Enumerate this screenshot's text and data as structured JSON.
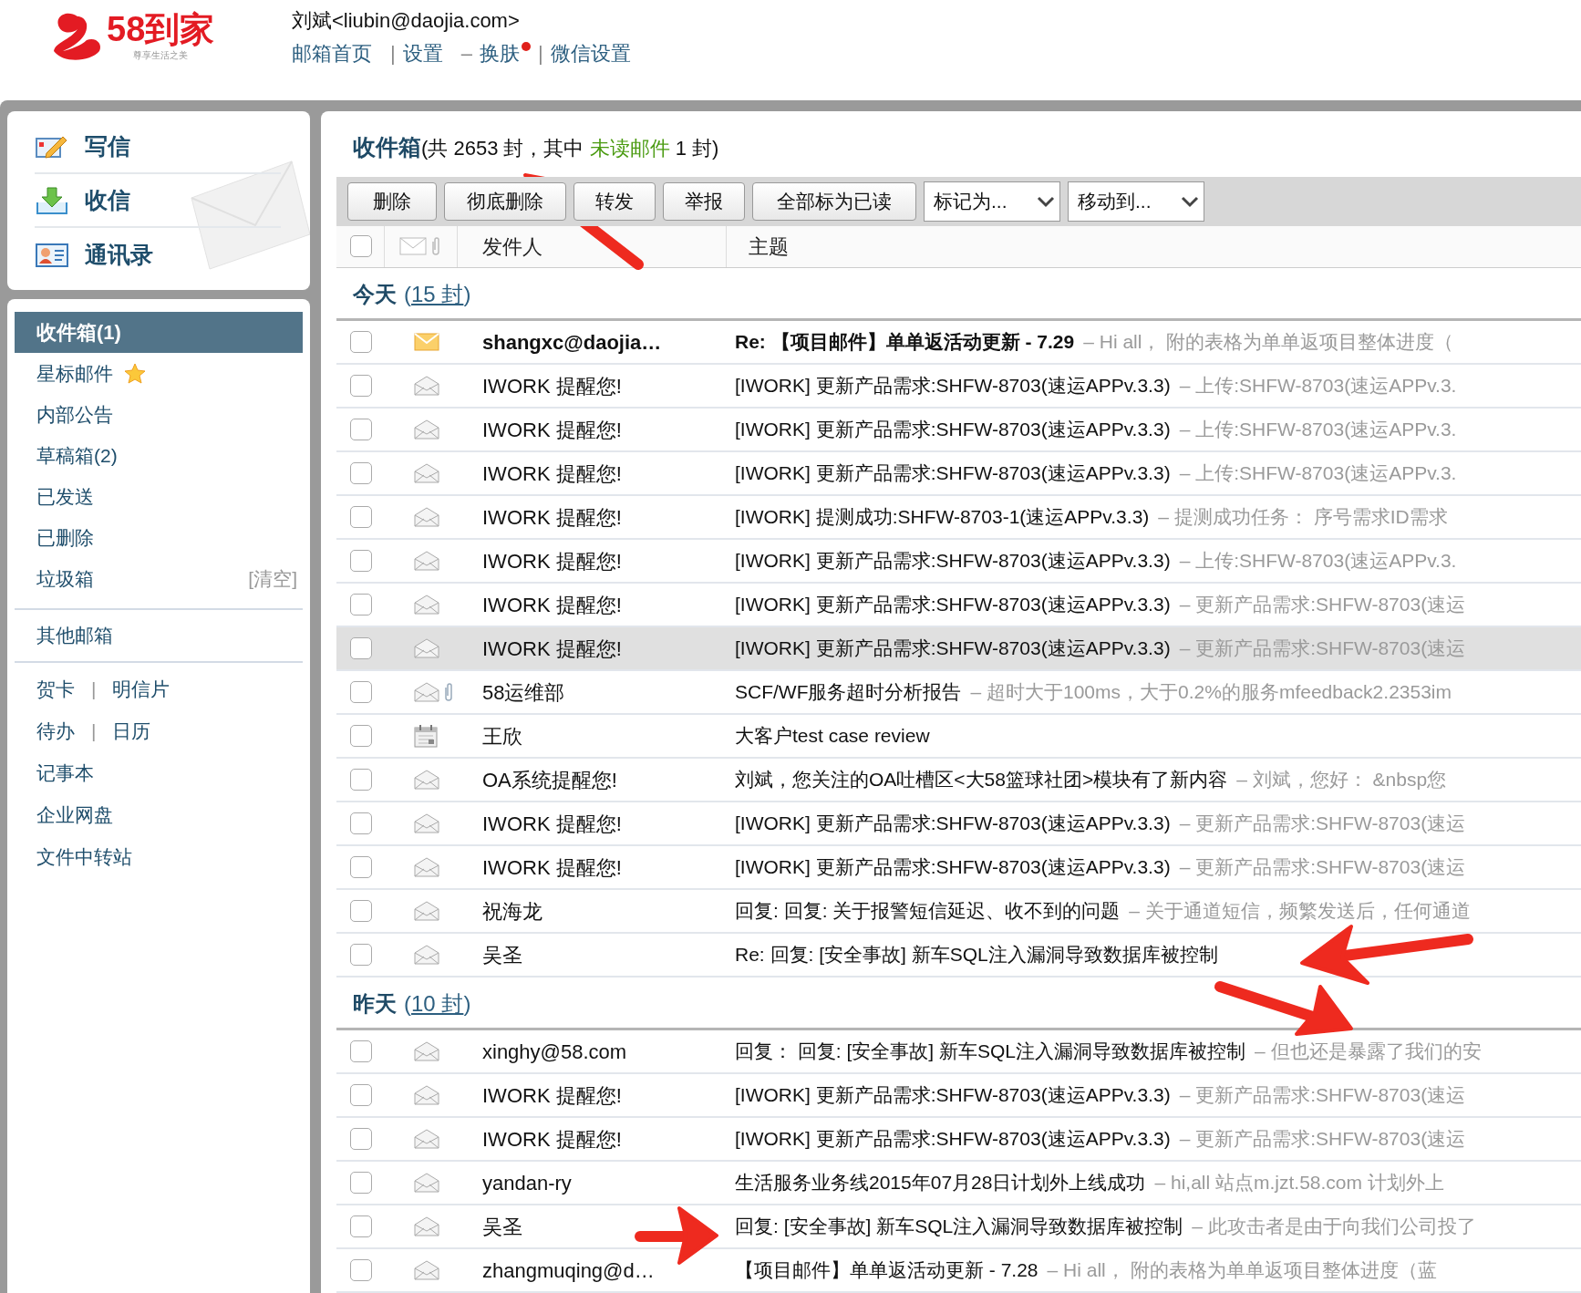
{
  "header": {
    "brand": "58到家",
    "tagline": "尊享生活之美",
    "user": "刘斌<liubin@daojia.com>",
    "nav": [
      {
        "kind": "link",
        "text": "邮箱首页",
        "badge": false
      },
      {
        "kind": "sep",
        "text": "|"
      },
      {
        "kind": "link",
        "text": "设置",
        "badge": false
      },
      {
        "kind": "sep",
        "text": "–"
      },
      {
        "kind": "link",
        "text": "换肤",
        "badge": true
      },
      {
        "kind": "sep",
        "text": "|"
      },
      {
        "kind": "link",
        "text": "微信设置",
        "badge": false
      }
    ]
  },
  "quick_actions": [
    {
      "kind": "compose",
      "label": "写信"
    },
    {
      "kind": "receive",
      "label": "收信"
    },
    {
      "kind": "contacts",
      "label": "通讯录"
    }
  ],
  "folders": [
    {
      "kind": "folder",
      "label": "收件箱(1)",
      "selected": true
    },
    {
      "kind": "starred",
      "label": "星标邮件",
      "selected": false
    },
    {
      "kind": "folder",
      "label": "内部公告",
      "selected": false
    },
    {
      "kind": "folder",
      "label": "草稿箱(2)",
      "selected": false
    },
    {
      "kind": "folder",
      "label": "已发送",
      "selected": false
    },
    {
      "kind": "folder",
      "label": "已删除",
      "selected": false
    },
    {
      "kind": "folder",
      "label": "垃圾箱",
      "selected": false,
      "action": "[清空]"
    }
  ],
  "other_mailbox": "其他邮箱",
  "tools": [
    {
      "items": [
        "贺卡",
        "明信片"
      ],
      "separator": "|"
    },
    {
      "items": [
        "待办",
        "日历"
      ],
      "separator": "|"
    },
    {
      "items": [
        "记事本"
      ]
    },
    {
      "items": [
        "企业网盘"
      ]
    },
    {
      "items": [
        "文件中转站"
      ]
    }
  ],
  "inbox": {
    "title": "收件箱",
    "summary_before": "(共 2653 封，其中 ",
    "unread_link": "未读邮件",
    "summary_after": " 1 封)"
  },
  "toolbar": {
    "buttons": [
      "删除",
      "彻底删除",
      "转发",
      "举报",
      "全部标为已读"
    ],
    "dropdowns": [
      "标记为...",
      "移动到..."
    ]
  },
  "columns": {
    "select_all_checked": false,
    "sender": "发件人",
    "subject": "主题"
  },
  "groups": [
    {
      "label": "今天",
      "open": "(",
      "count": "15 封",
      "close": ")",
      "rows": [
        {
          "kind": "unread",
          "attachment": false,
          "unread": true,
          "highlighted": false,
          "checked": false,
          "sender": "shangxc@daojia…",
          "subject": "Re: 【项目邮件】单单返活动更新 - 7.29",
          "preview": "– Hi all， 附的表格为单单返项目整体进度（"
        },
        {
          "kind": "read",
          "attachment": false,
          "unread": false,
          "highlighted": false,
          "checked": false,
          "sender": "IWORK 提醒您!",
          "subject": "[IWORK] 更新产品需求:SHFW-8703(速运APPv.3.3)",
          "preview": "– 上传:SHFW-8703(速运APPv.3."
        },
        {
          "kind": "read",
          "attachment": false,
          "unread": false,
          "highlighted": false,
          "checked": false,
          "sender": "IWORK 提醒您!",
          "subject": "[IWORK] 更新产品需求:SHFW-8703(速运APPv.3.3)",
          "preview": "– 上传:SHFW-8703(速运APPv.3."
        },
        {
          "kind": "read",
          "attachment": false,
          "unread": false,
          "highlighted": false,
          "checked": false,
          "sender": "IWORK 提醒您!",
          "subject": "[IWORK] 更新产品需求:SHFW-8703(速运APPv.3.3)",
          "preview": "– 上传:SHFW-8703(速运APPv.3."
        },
        {
          "kind": "read",
          "attachment": false,
          "unread": false,
          "highlighted": false,
          "checked": false,
          "sender": "IWORK 提醒您!",
          "subject": "[IWORK] 提测成功:SHFW-8703-1(速运APPv.3.3)",
          "preview": "– 提测成功任务：  序号需求ID需求"
        },
        {
          "kind": "read",
          "attachment": false,
          "unread": false,
          "highlighted": false,
          "checked": false,
          "sender": "IWORK 提醒您!",
          "subject": "[IWORK] 更新产品需求:SHFW-8703(速运APPv.3.3)",
          "preview": "– 上传:SHFW-8703(速运APPv.3."
        },
        {
          "kind": "read",
          "attachment": false,
          "unread": false,
          "highlighted": false,
          "checked": false,
          "sender": "IWORK 提醒您!",
          "subject": "[IWORK] 更新产品需求:SHFW-8703(速运APPv.3.3)",
          "preview": "– 更新产品需求:SHFW-8703(速运"
        },
        {
          "kind": "read",
          "attachment": false,
          "unread": false,
          "highlighted": true,
          "checked": false,
          "sender": "IWORK 提醒您!",
          "subject": "[IWORK] 更新产品需求:SHFW-8703(速运APPv.3.3)",
          "preview": "– 更新产品需求:SHFW-8703(速运"
        },
        {
          "kind": "read",
          "attachment": true,
          "unread": false,
          "highlighted": false,
          "checked": false,
          "sender": "58运维部",
          "subject": "SCF/WF服务超时分析报告",
          "preview": "– 超时大于100ms，大于0.2%的服务mfeedback2.2353im"
        },
        {
          "kind": "calendar",
          "attachment": false,
          "unread": false,
          "highlighted": false,
          "checked": false,
          "sender": "王欣",
          "subject": "大客户test case review"
        },
        {
          "kind": "read",
          "attachment": false,
          "unread": false,
          "highlighted": false,
          "checked": false,
          "sender": "OA系统提醒您!",
          "subject": "刘斌，您关注的OA吐槽区<大58篮球社团>模块有了新内容",
          "preview": "– 刘斌，您好：  &nbsp您"
        },
        {
          "kind": "read",
          "attachment": false,
          "unread": false,
          "highlighted": false,
          "checked": false,
          "sender": "IWORK 提醒您!",
          "subject": "[IWORK] 更新产品需求:SHFW-8703(速运APPv.3.3)",
          "preview": "– 更新产品需求:SHFW-8703(速运"
        },
        {
          "kind": "read",
          "attachment": false,
          "unread": false,
          "highlighted": false,
          "checked": false,
          "sender": "IWORK 提醒您!",
          "subject": "[IWORK] 更新产品需求:SHFW-8703(速运APPv.3.3)",
          "preview": "– 更新产品需求:SHFW-8703(速运"
        },
        {
          "kind": "read",
          "attachment": false,
          "unread": false,
          "highlighted": false,
          "checked": false,
          "sender": "祝海龙",
          "subject": "回复: 回复: 关于报警短信延迟、收不到的问题",
          "preview": "– 关于通道短信，频繁发送后，任何通道"
        },
        {
          "kind": "read",
          "attachment": false,
          "unread": false,
          "highlighted": false,
          "checked": false,
          "sender": "吴圣",
          "subject": "Re: 回复: [安全事故] 新车SQL注入漏洞导致数据库被控制"
        }
      ]
    },
    {
      "label": "昨天",
      "open": "(",
      "count": "10 封",
      "close": ")",
      "rows": [
        {
          "kind": "read",
          "attachment": false,
          "unread": false,
          "highlighted": false,
          "checked": false,
          "sender": "xinghy@58.com",
          "subject": "回复： 回复: [安全事故] 新车SQL注入漏洞导致数据库被控制",
          "preview": "– 但也还是暴露了我们的安"
        },
        {
          "kind": "read",
          "attachment": false,
          "unread": false,
          "highlighted": false,
          "checked": false,
          "sender": "IWORK 提醒您!",
          "subject": "[IWORK] 更新产品需求:SHFW-8703(速运APPv.3.3)",
          "preview": "– 更新产品需求:SHFW-8703(速运"
        },
        {
          "kind": "read",
          "attachment": false,
          "unread": false,
          "highlighted": false,
          "checked": false,
          "sender": "IWORK 提醒您!",
          "subject": "[IWORK] 更新产品需求:SHFW-8703(速运APPv.3.3)",
          "preview": "– 更新产品需求:SHFW-8703(速运"
        },
        {
          "kind": "read",
          "attachment": false,
          "unread": false,
          "highlighted": false,
          "checked": false,
          "sender": "yandan-ry",
          "subject": "生活服务业务线2015年07月28日计划外上线成功",
          "preview": "– hi,all 站点m.jzt.58.com 计划外上"
        },
        {
          "kind": "read",
          "attachment": false,
          "unread": false,
          "highlighted": false,
          "checked": false,
          "sender": "吴圣",
          "subject": "回复: [安全事故] 新车SQL注入漏洞导致数据库被控制",
          "preview": "– 此攻击者是由于向我们公司投了"
        },
        {
          "kind": "read",
          "attachment": false,
          "unread": false,
          "highlighted": false,
          "checked": false,
          "sender": "zhangmuqing@d…",
          "subject": "【项目邮件】单单返活动更新 - 7.28",
          "preview": "– Hi all， 附的表格为单单返项目整体进度（蓝"
        }
      ]
    }
  ]
}
